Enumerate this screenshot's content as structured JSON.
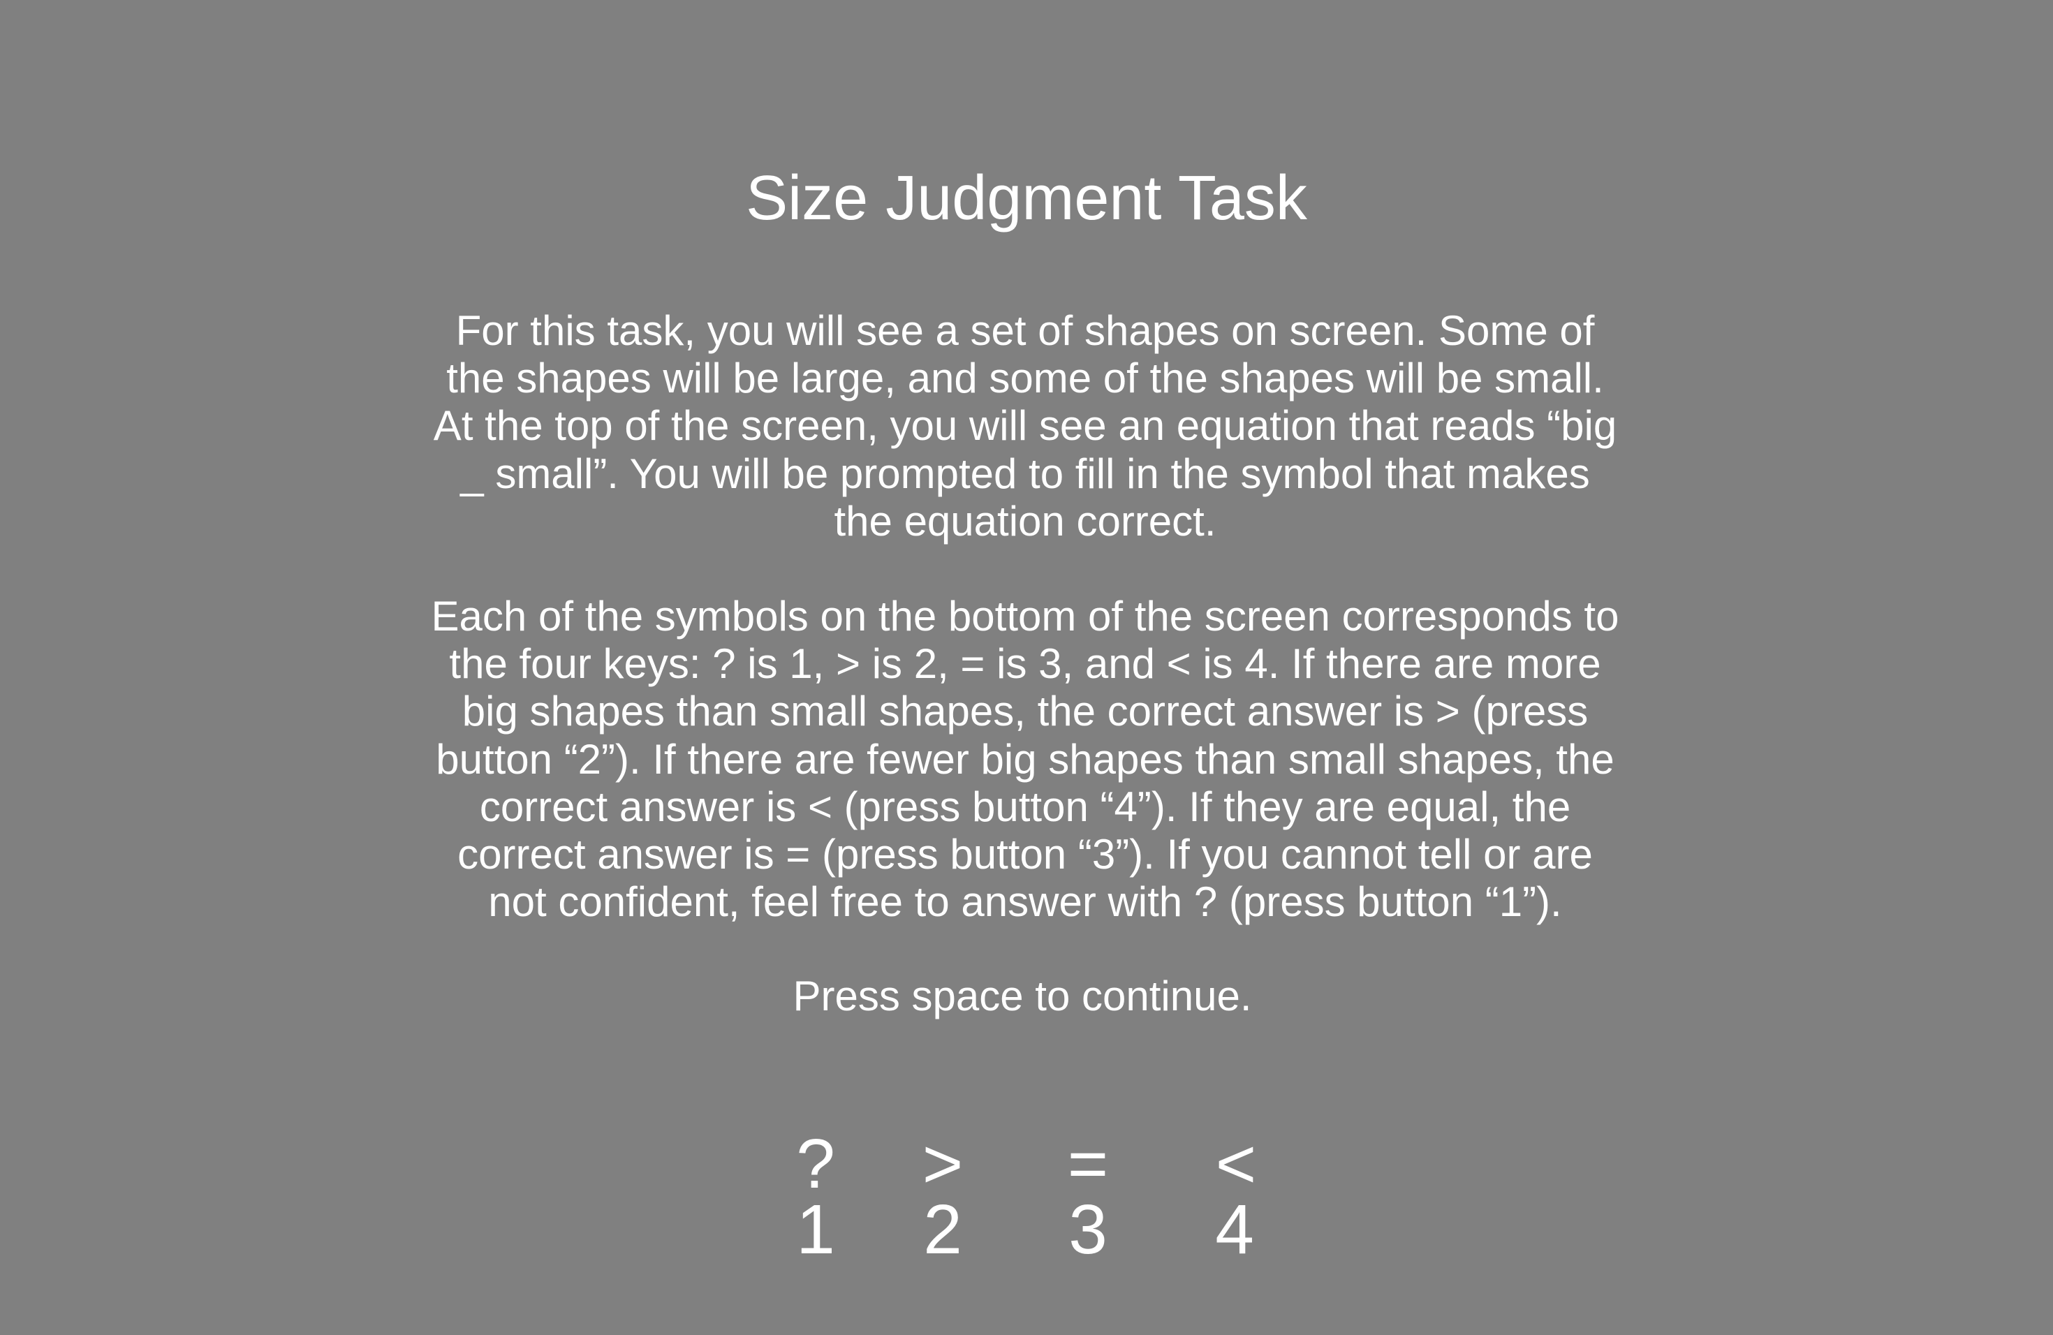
{
  "title": "Size Judgment Task",
  "paragraph1": [
    "For this task, you will see a set of shapes on screen. Some of",
    "the shapes will be large, and some of the shapes will be small.",
    "At the top of the screen, you will see an equation that reads “big",
    "_ small”. You will be prompted to fill in the symbol that makes",
    "the equation correct."
  ],
  "paragraph2": [
    "Each of the symbols on the bottom of the screen corresponds to",
    "the four keys: ? is 1, > is 2, = is 3, and < is 4. If there are more",
    "big shapes than small shapes, the correct answer is > (press",
    "button “2”). If there are fewer big shapes than small shapes, the",
    "correct answer is < (press button “4”). If they are equal, the",
    "correct answer is = (press button “3”). If you cannot tell or are",
    "not confident, feel free to answer with ? (press button “1”)."
  ],
  "continue_prompt": "Press space to continue.",
  "keys": [
    {
      "symbol": "?",
      "number": "1"
    },
    {
      "symbol": ">",
      "number": "2"
    },
    {
      "symbol": "=",
      "number": "3"
    },
    {
      "symbol": "<",
      "number": "4"
    }
  ]
}
